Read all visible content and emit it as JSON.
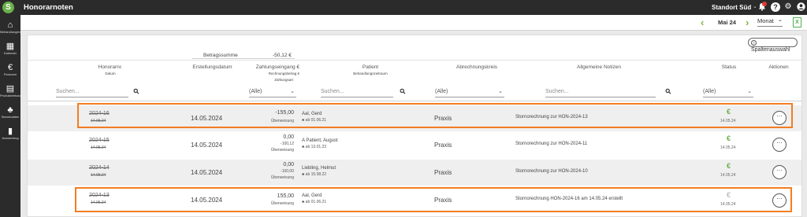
{
  "topbar": {
    "logo_letter": "S",
    "title": "Honorarnoten",
    "location": "Standort Süd",
    "location_chevron": "⌄"
  },
  "sidebar": {
    "items": [
      {
        "icon": "home-icon",
        "glyph": "⌂",
        "label": "Behandlungen"
      },
      {
        "icon": "calendar-icon",
        "glyph": "▦",
        "label": "Kalender"
      },
      {
        "icon": "euro-icon",
        "glyph": "€",
        "label": "Finanzen"
      },
      {
        "icon": "document-icon",
        "glyph": "▤",
        "label": "Produktverkauf"
      },
      {
        "icon": "hierarchy-icon",
        "glyph": "♣",
        "label": "Stammdaten"
      },
      {
        "icon": "chart-icon",
        "glyph": "▮",
        "label": "Auswertung"
      }
    ]
  },
  "subbar": {
    "prev": "‹",
    "month": "Mai 24",
    "next": "›",
    "period": "Monat",
    "period_chevron": "⌄",
    "excel": "X"
  },
  "column_button": "Spaltenauswahl",
  "summary": {
    "label": "Betragssumme",
    "value": "-50,12 €"
  },
  "columns": {
    "honorarnr": "Honorarnr.",
    "datum": "Datum",
    "erstellungsdatum": "Erstellungsdatum",
    "zahlungseingang": "Zahlungseingang €",
    "rechnungsbetrag": "Rechnungsbetrag €",
    "zahlungsart": "Zahlungsart",
    "patient": "Patient",
    "behandlungszeitraum": "Behandlungszeitraum",
    "abrechnungskreis": "Abrechnungskreis",
    "notizen": "Allgemeine Notizen",
    "status": "Status",
    "aktionen": "Aktionen"
  },
  "filters": {
    "search1_placeholder": "Suchen...",
    "zahlung_select": "(Alle)",
    "search2_placeholder": "Suchen...",
    "kreis_select": "(Alle)",
    "search3_placeholder": "Suchen...",
    "status_select": "(Alle)"
  },
  "rows": [
    {
      "nr": "2024-16",
      "date": "14.05.24",
      "created": "14.05.2024",
      "amount": "-155,00",
      "amount_sub": "",
      "method": "Überweisung",
      "patient": "Aal, Gerd",
      "patient_sub": "♣ ab 01.06.21",
      "kreis": "Praxis",
      "note": "Stornorechnung zur HON-2024-13",
      "status_date": "14.05.24",
      "action": "···"
    },
    {
      "nr": "2024-15",
      "date": "14.05.24",
      "created": "14.05.2024",
      "amount": "0,00",
      "amount_sub": "-100,12",
      "method": "Überweisung",
      "patient": "A Patient, August",
      "patient_sub": "♣ ab 13.01.23",
      "kreis": "Praxis",
      "note": "Stornorechnung zur HON-2024-11",
      "status_date": "14.05.24",
      "action": "···"
    },
    {
      "nr": "2024-14",
      "date": "14.05.24",
      "created": "14.05.2024",
      "amount": "0,00",
      "amount_sub": "-100,00",
      "method": "Überweisung",
      "patient": "Liebling, Helmut",
      "patient_sub": "♣ ab 15.08.22",
      "kreis": "Praxis",
      "note": "Stornorechnung zur HON-2024-10",
      "status_date": "14.05.24",
      "action": "···"
    },
    {
      "nr": "2024-13",
      "date": "14.05.24",
      "created": "14.05.2024",
      "amount": "155,00",
      "amount_sub": "",
      "method": "Überweisung",
      "patient": "Aal, Gerd",
      "patient_sub": "♣ ab 01.06.21",
      "kreis": "Praxis",
      "note": "Stornorechnung HON-2024-16 am 14.05.24 erstellt",
      "status_date": "14.05.24",
      "action": "···"
    }
  ],
  "glyphs": {
    "euro": "€",
    "search": "⚲",
    "chevron": "⌄",
    "bell": "🔔",
    "help": "?",
    "gear": "⚙",
    "user": "●",
    "cols_icon": "≡"
  },
  "colors": {
    "topbar": "#2b2b2b",
    "accent_green": "#6bb14a",
    "highlight_orange": "#f37d22"
  }
}
